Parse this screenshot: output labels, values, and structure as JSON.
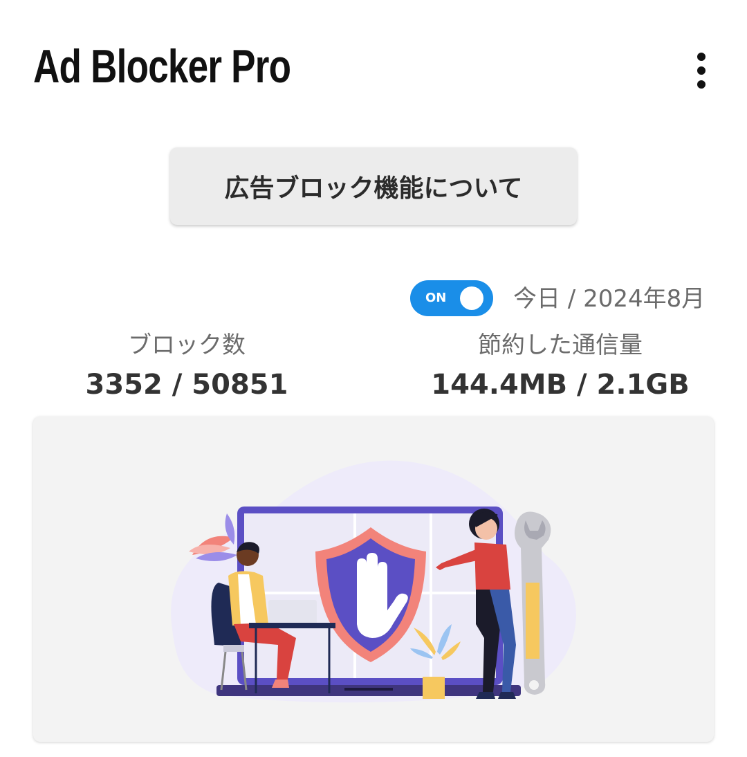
{
  "header": {
    "title": "Ad Blocker Pro",
    "menu_icon": "more-vert-icon"
  },
  "about_button": {
    "label": "広告ブロック機能について"
  },
  "toggle": {
    "label": "ON",
    "state": "on",
    "color": "#1a8ee8"
  },
  "period": {
    "label": "今日 / 2024年8月"
  },
  "stats": [
    {
      "label": "ブロック数",
      "value": "3352 / 50851"
    },
    {
      "label": "節約した通信量",
      "value": "144.4MB / 2.1GB"
    }
  ],
  "colors": {
    "accent": "#1a8ee8",
    "shield": "#5b4fc4",
    "shield_border": "#f2837a"
  }
}
